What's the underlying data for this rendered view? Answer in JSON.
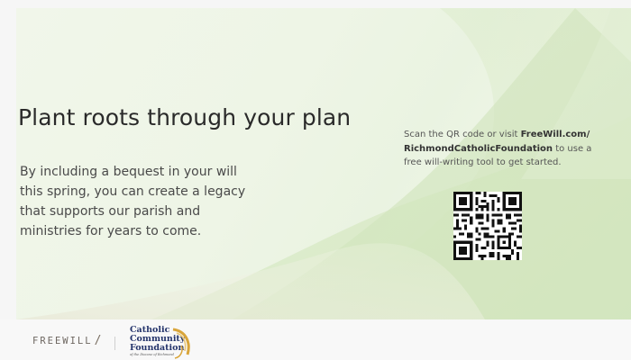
{
  "headline": "Plant roots through your plan",
  "body": "By including a bequest in your will this spring, you can create a legacy that supports our parish and ministries for years to come.",
  "qr_instructions": {
    "prefix": "Scan the QR code or visit ",
    "link_line1": "FreeWill.com/",
    "link_line2": "RichmondCatholicFoundation",
    "suffix": " to use a free will-writing tool to get started."
  },
  "footer": {
    "freewill_logo_text": "FREEWILL",
    "ccf_logo_line1": "Catholic",
    "ccf_logo_line2": "Community",
    "ccf_logo_line3": "Foundation",
    "ccf_logo_tagline": "of the Diocese of Richmond"
  },
  "colors": {
    "background": "#eef5e6",
    "accent_green": "#cfe3b8",
    "headline": "#2a2a2a",
    "ccf_blue": "#24346b",
    "ccf_gold": "#d9a53a"
  }
}
